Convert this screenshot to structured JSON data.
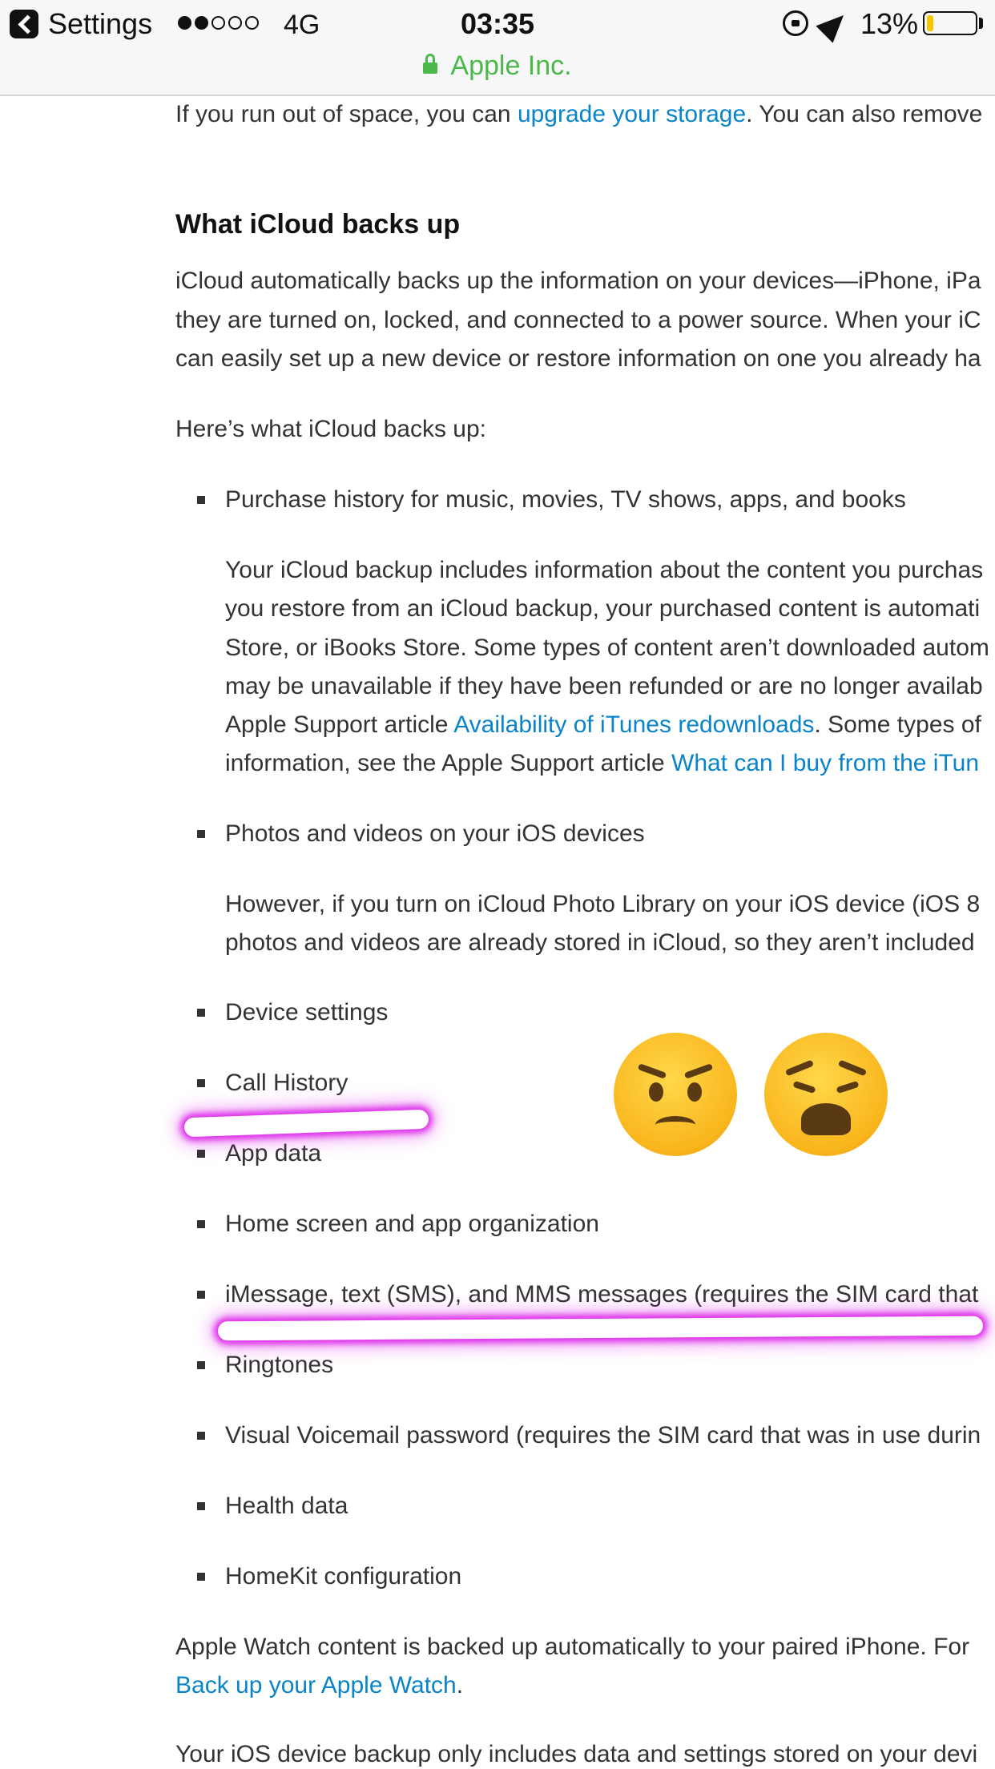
{
  "status_bar": {
    "back_label": "Settings",
    "signal_bars": [
      true,
      true,
      false,
      false,
      false
    ],
    "network": "4G",
    "time": "03:35",
    "battery_percent": "13%",
    "battery_level": 0.13,
    "battery_color": "#f4c800"
  },
  "url_bar": {
    "site_label": "Apple Inc.",
    "secure_color": "#4cb74c"
  },
  "article": {
    "intro": {
      "before_link": "If you run out of space, you can ",
      "link": "upgrade your storage",
      "after_link": ". You can also remove"
    },
    "heading": "What iCloud backs up",
    "para1": [
      "iCloud automatically backs up the information on your devices—iPhone, iPa",
      "they are turned on, locked, and connected to a power source. When your iC",
      "can easily set up a new device or restore information on one you already ha"
    ],
    "list_intro": "Here’s what iCloud backs up:",
    "items": {
      "purchase": "Purchase history for music, movies, TV shows, apps, and books",
      "photos": "Photos and videos on your iOS devices",
      "device_settings": "Device settings",
      "call_history": "Call History",
      "app_data": "App data",
      "home_screen": "Home screen and app organization",
      "imessage": "iMessage, text (SMS), and MMS messages (requires the SIM card that",
      "ringtones": "Ringtones",
      "voicemail": "Visual Voicemail password (requires the SIM card that was in use durin",
      "health": "Health data",
      "homekit": "HomeKit configuration"
    },
    "purchase_detail": {
      "lines": [
        "Your iCloud backup includes information about the content you purchas",
        "you restore from an iCloud backup, your purchased content is automati",
        "Store, or iBooks Store. Some types of content aren’t downloaded autom",
        "may be unavailable if they have been refunded or are no longer availab"
      ],
      "line5_before": "Apple Support article ",
      "line5_link": "Availability of iTunes redownloads",
      "line5_after": ". Some types of",
      "line6_before": "information, see the Apple Support article ",
      "line6_link": "What can I buy from the iTun"
    },
    "photos_detail": [
      "However, if you turn on iCloud Photo Library on your iOS device (iOS 8",
      "photos and videos are already stored in iCloud, so they aren’t included"
    ],
    "watch": {
      "text": "Apple Watch content is backed up automatically to your paired iPhone. For",
      "link": "Back up your Apple Watch",
      "after_link": "."
    },
    "footer": "Your iOS device backup only includes data and settings stored on your devi",
    "link_color": "#0a84c8"
  },
  "annotations": {
    "highlight_color": "#d600e6",
    "emojis": [
      "angry-face",
      "weary-face"
    ]
  }
}
